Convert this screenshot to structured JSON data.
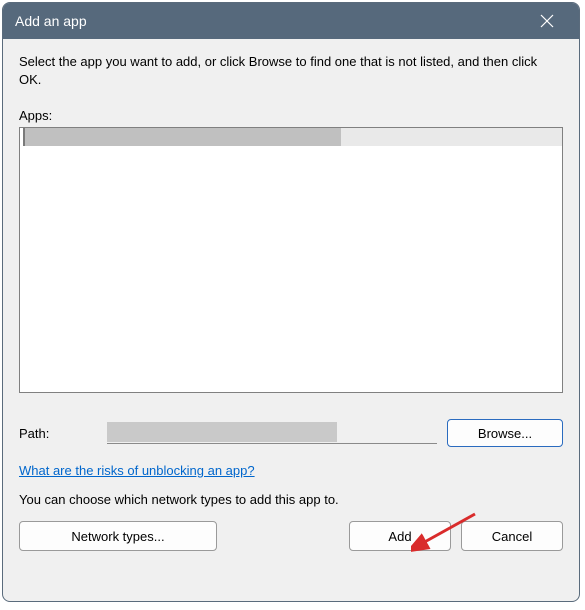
{
  "titlebar": {
    "title": "Add an app"
  },
  "instruction": "Select the app you want to add, or click Browse to find one that is not listed, and then click OK.",
  "apps_label": "Apps:",
  "path": {
    "label": "Path:",
    "browse": "Browse..."
  },
  "risks_link": "What are the risks of unblocking an app?",
  "network_text": "You can choose which network types to add this app to.",
  "buttons": {
    "network_types": "Network types...",
    "add": "Add",
    "cancel": "Cancel"
  }
}
